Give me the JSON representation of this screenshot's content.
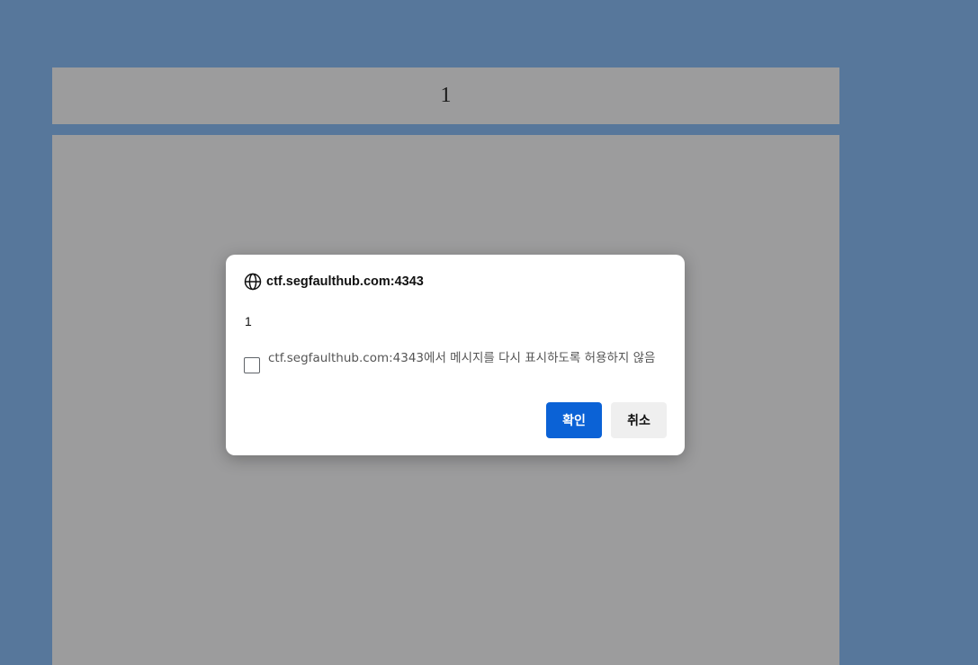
{
  "page": {
    "header_text": "1"
  },
  "dialog": {
    "origin": "ctf.segfaulthub.com:4343",
    "origin_icon": "globe-icon",
    "message": "1",
    "suppress_label": "ctf.segfaulthub.com:4343에서 메시지를 다시 표시하도록 허용하지 않음",
    "suppress_checked": false,
    "ok_label": "확인",
    "cancel_label": "취소"
  },
  "colors": {
    "background": "#57779b",
    "page_panel": "#9c9c9d",
    "ok_button": "#0b62d6",
    "cancel_button": "#efefef"
  }
}
